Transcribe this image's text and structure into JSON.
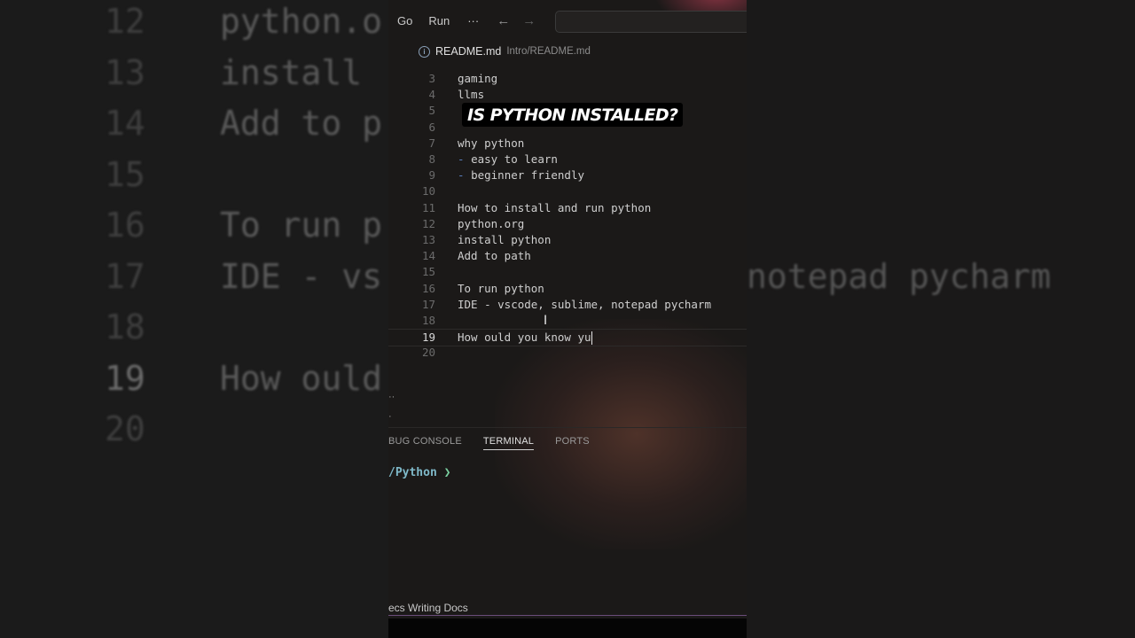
{
  "menubar": {
    "go": "Go",
    "run": "Run",
    "more": "···",
    "back": "←",
    "forward": "→"
  },
  "tab": {
    "file": "README.md",
    "path": "Intro/README.md"
  },
  "code_lines": [
    {
      "n": "3",
      "t": "gaming"
    },
    {
      "n": "4",
      "t": "llms"
    },
    {
      "n": "5",
      "t": ""
    },
    {
      "n": "6",
      "t": ""
    },
    {
      "n": "7",
      "t": "why python"
    },
    {
      "n": "8",
      "t": "easy to learn",
      "dash": "-"
    },
    {
      "n": "9",
      "t": "beginner friendly",
      "dash": "-"
    },
    {
      "n": "10",
      "t": ""
    },
    {
      "n": "11",
      "t": "How to install and run python"
    },
    {
      "n": "12",
      "t": "python.org"
    },
    {
      "n": "13",
      "t": "install python"
    },
    {
      "n": "14",
      "t": "Add to path"
    },
    {
      "n": "15",
      "t": ""
    },
    {
      "n": "16",
      "t": "To run python"
    },
    {
      "n": "17",
      "t": "IDE - vscode, sublime, notepad pycharm"
    },
    {
      "n": "18",
      "t": ""
    },
    {
      "n": "19",
      "t": "How ould you know yu",
      "current": true
    },
    {
      "n": "20",
      "t": ""
    }
  ],
  "caption": "IS PYTHON INSTALLED?",
  "panel": {
    "tab1": "BUG CONSOLE",
    "tab2": "TERMINAL",
    "tab3": "PORTS"
  },
  "terminal": {
    "path": "/Python",
    "arrow": "❯"
  },
  "status": {
    "text": "ecs Writing Docs"
  },
  "backdrop": {
    "left_rows": [
      {
        "n": "12",
        "t": "python.o"
      },
      {
        "n": "13",
        "t": "install"
      },
      {
        "n": "14",
        "t": "Add to p"
      },
      {
        "n": "15",
        "t": ""
      },
      {
        "n": "16",
        "t": "To run p"
      },
      {
        "n": "17",
        "t": "IDE - vs"
      },
      {
        "n": "18",
        "t": ""
      },
      {
        "n": "19",
        "t": "How ould"
      },
      {
        "n": "20",
        "t": ""
      }
    ],
    "right_text": "notepad pycharm"
  }
}
